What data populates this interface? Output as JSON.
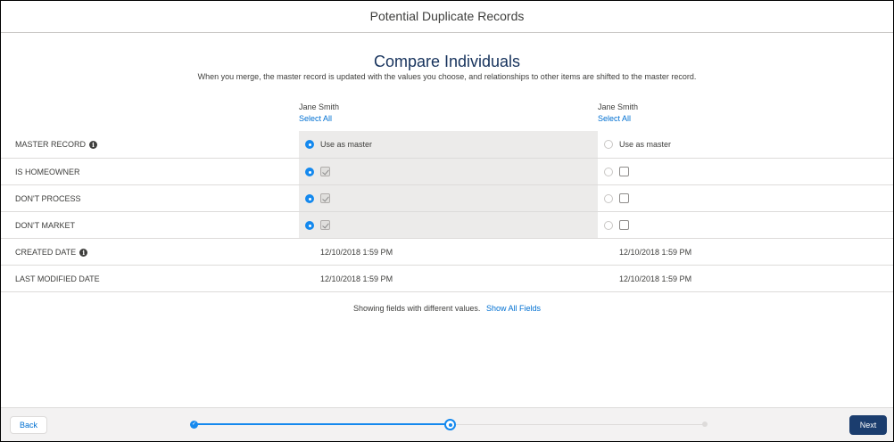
{
  "header": {
    "title": "Potential Duplicate Records"
  },
  "main": {
    "heading": "Compare Individuals",
    "subtext": "When you merge, the master record is updated with the values you choose, and relationships to other items are shifted to the master record.",
    "columns": [
      {
        "name": "Jane Smith",
        "select_all": "Select All"
      },
      {
        "name": "Jane Smith",
        "select_all": "Select All"
      }
    ],
    "rows": {
      "master": {
        "label": "MASTER RECORD",
        "option_label": "Use as master",
        "selected_column": 1
      },
      "homeowner": {
        "label": "IS HOMEOWNER",
        "values": [
          true,
          false
        ],
        "selected_column": 1
      },
      "dont_process": {
        "label": "DON'T PROCESS",
        "values": [
          true,
          false
        ],
        "selected_column": 1
      },
      "dont_market": {
        "label": "DON'T MARKET",
        "values": [
          true,
          false
        ],
        "selected_column": 1
      },
      "created": {
        "label": "CREATED DATE",
        "values": [
          "12/10/2018 1:59 PM",
          "12/10/2018 1:59 PM"
        ]
      },
      "modified": {
        "label": "LAST MODIFIED DATE",
        "values": [
          "12/10/2018 1:59 PM",
          "12/10/2018 1:59 PM"
        ]
      }
    },
    "footer_note": {
      "text": "Showing fields with different values.",
      "link": "Show All Fields"
    }
  },
  "footer": {
    "back_label": "Back",
    "next_label": "Next",
    "progress": {
      "steps": 3,
      "current_step": 2
    }
  },
  "colors": {
    "accent": "#1589ee",
    "link": "#0070d2",
    "next_button": "#1b3d6e",
    "selected_column_bg": "#ecebea"
  }
}
